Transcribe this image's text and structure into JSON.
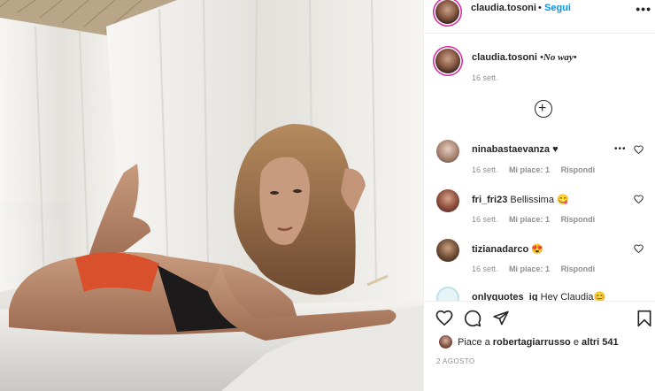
{
  "header": {
    "username": "claudia.tosoni",
    "separator": "•",
    "follow_label": "Segui",
    "more_label": "•••",
    "more_icon": "more-dots-icon"
  },
  "caption": {
    "username": "claudia.tosoni",
    "text": "•No way•",
    "date": "16 sett."
  },
  "load_more": {
    "icon": "plus-circle-icon",
    "glyph": "+"
  },
  "comments": [
    {
      "username": "ninabastaevanza",
      "text": "♥",
      "date": "16 sett.",
      "likes": "Mi piace: 1",
      "reply": "Rispondi",
      "options": "•••"
    },
    {
      "username": "fri_fri23",
      "text": "Bellissima 😋",
      "date": "16 sett.",
      "likes": "Mi piace: 1",
      "reply": "Rispondi"
    },
    {
      "username": "tizianadarco",
      "text": "😍",
      "date": "16 sett.",
      "likes": "Mi piace: 1",
      "reply": "Rispondi"
    },
    {
      "username": "onlyquotes_ig",
      "text": "Hey Claudia😊"
    }
  ],
  "actions": {
    "like_icon": "heart-icon",
    "comment_icon": "comment-icon",
    "share_icon": "paper-plane-icon",
    "save_icon": "bookmark-icon"
  },
  "likes_summary": {
    "prefix": "Piace a ",
    "user": "robertagiarrusso",
    "middle": " e ",
    "others": "altri 541"
  },
  "post_date": "2 AGOSTO",
  "colors": {
    "accent": "#0095f6",
    "text": "#262626",
    "muted": "#8e8e8e",
    "story_ring": "#d6249f"
  }
}
